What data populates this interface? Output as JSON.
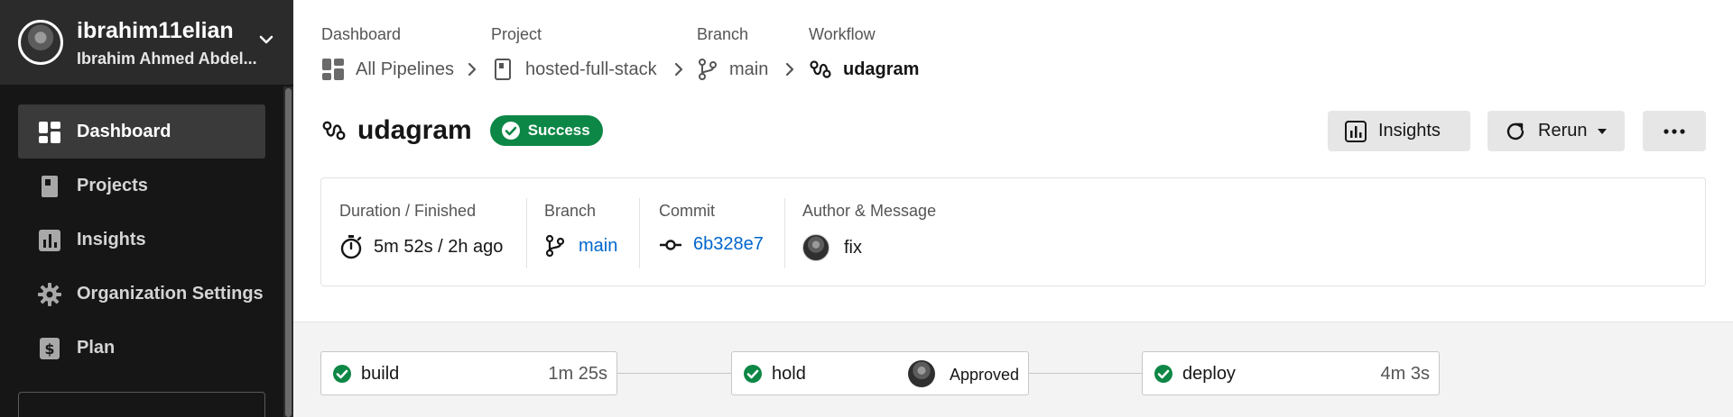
{
  "user": {
    "username": "ibrahim11elian",
    "full_name": "Ibrahim Ahmed Abdel..."
  },
  "sidebar": {
    "items": [
      {
        "label": "Dashboard",
        "icon": "dashboard-icon",
        "active": true
      },
      {
        "label": "Projects",
        "icon": "project-icon",
        "active": false
      },
      {
        "label": "Insights",
        "icon": "insights-icon",
        "active": false
      },
      {
        "label": "Organization Settings",
        "icon": "gear-icon",
        "active": false
      },
      {
        "label": "Plan",
        "icon": "dollar-icon",
        "active": false
      }
    ]
  },
  "breadcrumb": {
    "dashboard": {
      "label": "Dashboard",
      "value": "All Pipelines"
    },
    "project": {
      "label": "Project",
      "value": "hosted-full-stack"
    },
    "branch": {
      "label": "Branch",
      "value": "main"
    },
    "workflow": {
      "label": "Workflow",
      "value": "udagram"
    }
  },
  "workflow": {
    "title": "udagram",
    "status": "Success"
  },
  "actions": {
    "insights": "Insights",
    "rerun": "Rerun"
  },
  "summary": {
    "duration_label": "Duration / Finished",
    "duration_value": "5m 52s / 2h ago",
    "branch_label": "Branch",
    "branch_value": "main",
    "commit_label": "Commit",
    "commit_value": "6b328e7",
    "author_label": "Author & Message",
    "author_message": "fix"
  },
  "jobs": [
    {
      "name": "build",
      "time": "1m 25s",
      "status": "success"
    },
    {
      "name": "hold",
      "approval": "Approved",
      "status": "success"
    },
    {
      "name": "deploy",
      "time": "4m 3s",
      "status": "success"
    }
  ],
  "colors": {
    "success": "#0d8745",
    "link": "#0066cc",
    "sidebar_bg": "#161616"
  }
}
